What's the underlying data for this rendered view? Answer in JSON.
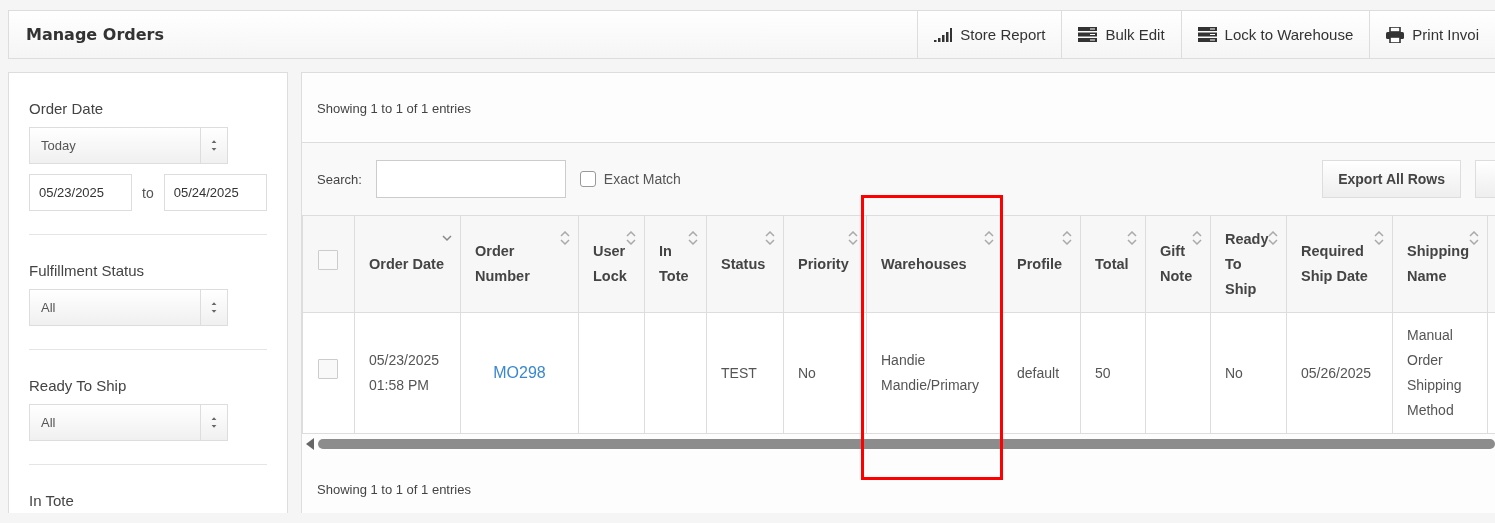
{
  "header": {
    "title": "Manage Orders",
    "actions": [
      {
        "label": "Store Report"
      },
      {
        "label": "Bulk Edit"
      },
      {
        "label": "Lock to Warehouse"
      },
      {
        "label": "Print Invoi"
      }
    ]
  },
  "filters": [
    {
      "kind": "daterange",
      "label": "Order Date",
      "select": "Today",
      "from": "05/23/2025",
      "separator": "to",
      "to": "05/24/2025"
    },
    {
      "kind": "select",
      "label": "Fulfillment Status",
      "select": "All"
    },
    {
      "kind": "select",
      "label": "Ready To Ship",
      "select": "All"
    },
    {
      "kind": "select",
      "label": "In Tote"
    }
  ],
  "summary_top": "Showing 1 to 1 of 1 entries",
  "search": {
    "label": "Search:"
  },
  "exact_match": {
    "label": "Exact Match",
    "checked": false
  },
  "export_button": "Export All Rows",
  "table": {
    "select_all": {
      "checked": false
    },
    "columns": [
      {
        "label": "Order Date",
        "sorted": true
      },
      {
        "label": "Order Number",
        "sorted": false
      },
      {
        "label": "User Lock",
        "sorted": false
      },
      {
        "label": "In Tote",
        "sorted": false
      },
      {
        "label": "Status",
        "sorted": false
      },
      {
        "label": "Priority",
        "sorted": false
      },
      {
        "label": "Warehouses",
        "sorted": false,
        "highlighted": true
      },
      {
        "label": "Profile",
        "sorted": false
      },
      {
        "label": "Total",
        "sorted": false
      },
      {
        "label": "Gift Note",
        "sorted": false
      },
      {
        "label": "Ready To Ship",
        "sorted": false
      },
      {
        "label": "Required Ship Date",
        "sorted": false
      },
      {
        "label": "Shipping Name",
        "sorted": false
      }
    ],
    "rows": [
      {
        "checked": false,
        "cells": [
          {
            "text": "05/23/2025 01:58 PM"
          },
          {
            "text": "MO298",
            "link": true
          },
          {},
          {},
          {
            "text": "TEST"
          },
          {
            "text": "No"
          },
          {
            "text": "Handie Mandie/Primary"
          },
          {
            "text": "default"
          },
          {
            "text": "50"
          },
          {},
          {
            "text": "No"
          },
          {
            "text": "05/26/2025"
          },
          {
            "text": "Manual Order Shipping Method"
          }
        ]
      }
    ]
  },
  "summary_bottom": "Showing 1 to 1 of 1 entries"
}
